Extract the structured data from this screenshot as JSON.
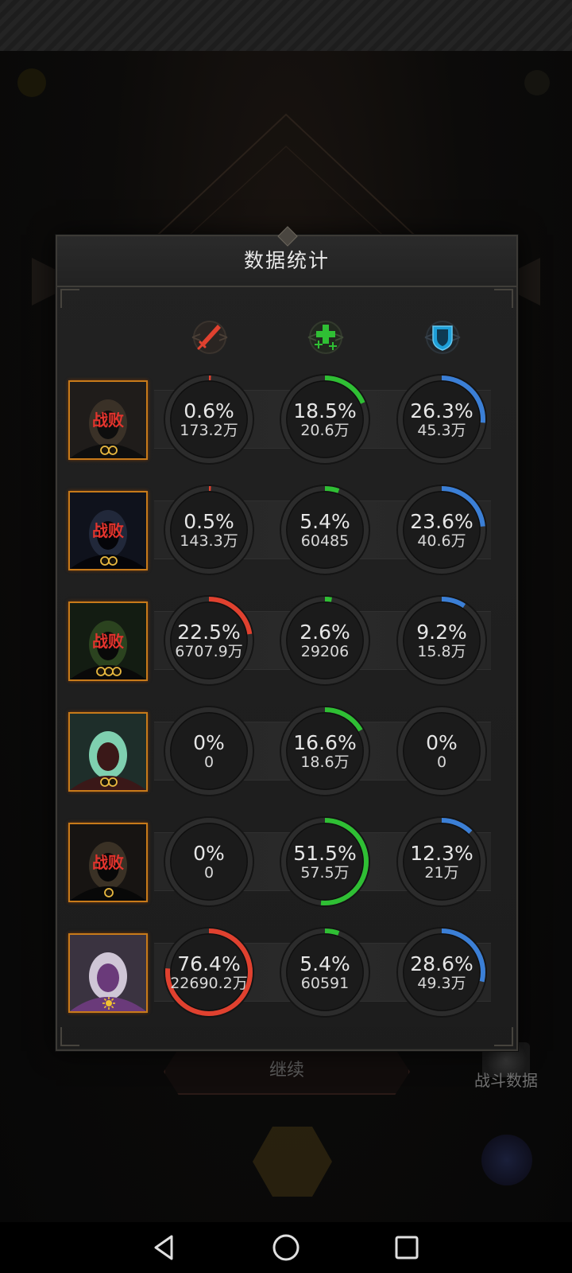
{
  "dialog": {
    "title": "数据统计"
  },
  "background": {
    "continue_label": "继续",
    "battle_data_label": "战斗数据"
  },
  "columns": [
    {
      "name": "damage",
      "icon": "sword-icon",
      "color": "#e0412f"
    },
    {
      "name": "heal",
      "icon": "heal-cross-icon",
      "color": "#2fbf34"
    },
    {
      "name": "tank",
      "icon": "shield-icon",
      "color": "#3b7fd6"
    }
  ],
  "heroes": [
    {
      "defeated": true,
      "defeat_label": "战败",
      "rank": "two-coin",
      "damage": {
        "percent_value": 0.6,
        "percent": "0.6%",
        "amount": "173.2万"
      },
      "heal": {
        "percent_value": 18.5,
        "percent": "18.5%",
        "amount": "20.6万"
      },
      "tank": {
        "percent_value": 26.3,
        "percent": "26.3%",
        "amount": "45.3万"
      }
    },
    {
      "defeated": true,
      "defeat_label": "战败",
      "rank": "two-coin",
      "damage": {
        "percent_value": 0.5,
        "percent": "0.5%",
        "amount": "143.3万"
      },
      "heal": {
        "percent_value": 5.4,
        "percent": "5.4%",
        "amount": "60485"
      },
      "tank": {
        "percent_value": 23.6,
        "percent": "23.6%",
        "amount": "40.6万"
      }
    },
    {
      "defeated": true,
      "defeat_label": "战败",
      "rank": "three-coin",
      "damage": {
        "percent_value": 22.5,
        "percent": "22.5%",
        "amount": "6707.9万"
      },
      "heal": {
        "percent_value": 2.6,
        "percent": "2.6%",
        "amount": "29206"
      },
      "tank": {
        "percent_value": 9.2,
        "percent": "9.2%",
        "amount": "15.8万"
      }
    },
    {
      "defeated": false,
      "defeat_label": "",
      "rank": "two-coin",
      "damage": {
        "percent_value": 0,
        "percent": "0%",
        "amount": "0"
      },
      "heal": {
        "percent_value": 16.6,
        "percent": "16.6%",
        "amount": "18.6万"
      },
      "tank": {
        "percent_value": 0,
        "percent": "0%",
        "amount": "0"
      }
    },
    {
      "defeated": true,
      "defeat_label": "战败",
      "rank": "one-coin",
      "damage": {
        "percent_value": 0,
        "percent": "0%",
        "amount": "0"
      },
      "heal": {
        "percent_value": 51.5,
        "percent": "51.5%",
        "amount": "57.5万"
      },
      "tank": {
        "percent_value": 12.3,
        "percent": "12.3%",
        "amount": "21万"
      }
    },
    {
      "defeated": false,
      "defeat_label": "",
      "rank": "sun",
      "damage": {
        "percent_value": 76.4,
        "percent": "76.4%",
        "amount": "22690.2万"
      },
      "heal": {
        "percent_value": 5.4,
        "percent": "5.4%",
        "amount": "60591"
      },
      "tank": {
        "percent_value": 28.6,
        "percent": "28.6%",
        "amount": "49.3万"
      }
    }
  ],
  "navbar": {
    "back_icon": "back-triangle-icon",
    "home_icon": "home-circle-icon",
    "recents_icon": "recents-square-icon"
  }
}
